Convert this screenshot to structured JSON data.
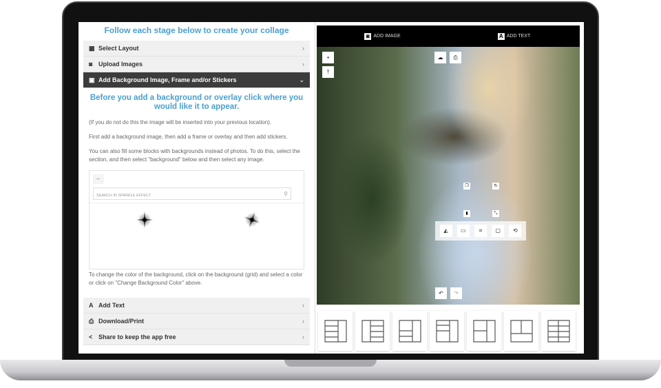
{
  "left": {
    "title": "Follow each stage below to create your collage",
    "steps": [
      {
        "label": "Select Layout",
        "icon": "grid-icon"
      },
      {
        "label": "Upload Images",
        "icon": "camera-icon"
      },
      {
        "label": "Add Background Image, Frame and/or Stickers",
        "icon": "image-icon",
        "active": true
      },
      {
        "label": "Add Text",
        "icon": "font-icon"
      },
      {
        "label": "Download/Print",
        "icon": "print-icon"
      },
      {
        "label": "Share to keep the app free",
        "icon": "share-icon"
      }
    ],
    "heading": "Before you add a background or overlay click where you would like it to appear.",
    "p1": "(If you do not do this the image will be inserted into your previous location).",
    "p2": "First add a background image, then add a frame or overlay and then add stickers.",
    "p3": "You can also fill some blocks with backgrounds instead of photos. To do this, select the section, and then select \"background\" below and then select any image.",
    "search_placeholder": "SEARCH IN SPARKLE EFFECT",
    "p4": "To change the color of the background, click on the background (grid) and select a color or click on \"Change Background Color\" above."
  },
  "right": {
    "tabs": [
      {
        "label": "ADD IMAGE",
        "icon": "camera-icon"
      },
      {
        "label": "ADD TEXT",
        "icon": "text-icon"
      }
    ],
    "layout_count": 7
  },
  "colors": {
    "accent": "#4a9fd0",
    "active_step": "#3c3c3c"
  }
}
